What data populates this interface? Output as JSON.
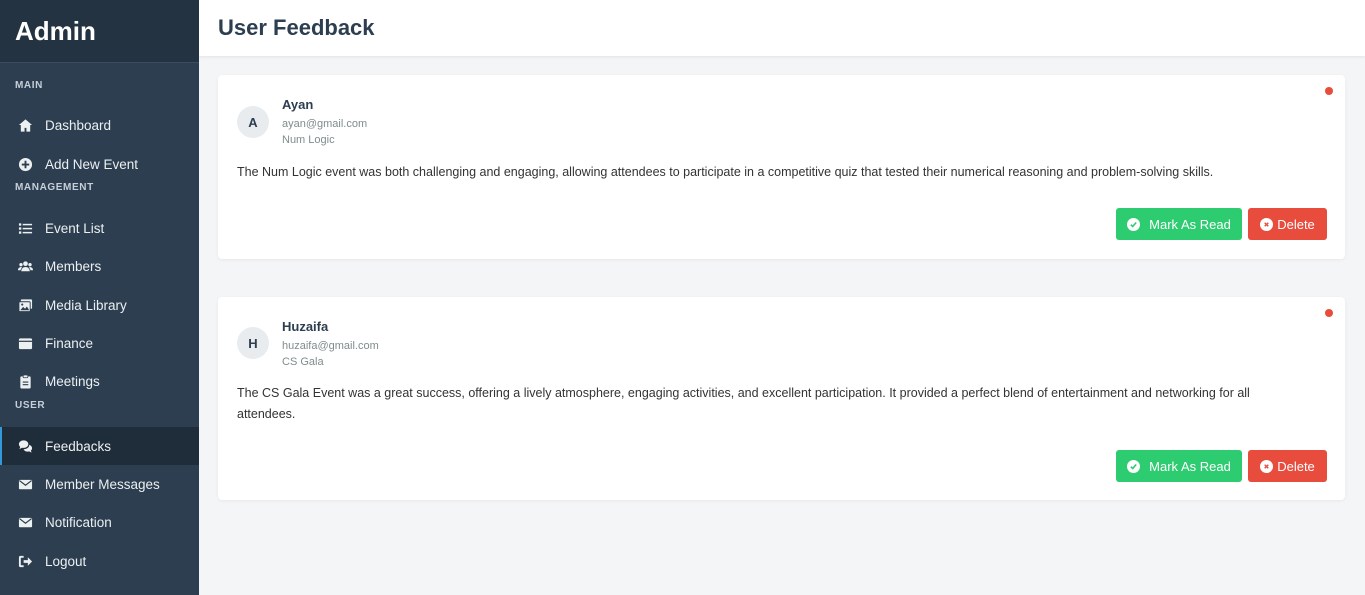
{
  "sidebar": {
    "brand": "Admin",
    "sections": {
      "main": "MAIN",
      "management": "MANAGEMENT",
      "user": "USER"
    },
    "items": [
      {
        "label": "Dashboard",
        "icon": "home-icon"
      },
      {
        "label": "Add New Event",
        "icon": "plus-circle-icon"
      },
      {
        "label": "Event List",
        "icon": "list-icon"
      },
      {
        "label": "Members",
        "icon": "users-icon"
      },
      {
        "label": "Media Library",
        "icon": "images-icon"
      },
      {
        "label": "Finance",
        "icon": "wallet-icon"
      },
      {
        "label": "Meetings",
        "icon": "clipboard-icon"
      },
      {
        "label": "Feedbacks",
        "icon": "comments-icon"
      },
      {
        "label": "Member Messages",
        "icon": "envelope-icon"
      },
      {
        "label": "Notification",
        "icon": "envelope-icon"
      },
      {
        "label": "Logout",
        "icon": "sign-out-icon"
      }
    ],
    "active": "Feedbacks"
  },
  "header": {
    "title": "User Feedback"
  },
  "feedbacks": [
    {
      "initial": "A",
      "name": "Ayan",
      "email": "ayan@gmail.com",
      "event": "Num Logic",
      "message": "The Num Logic event was both challenging and engaging, allowing attendees to participate in a competitive quiz that tested their numerical reasoning and problem-solving skills.",
      "unread": true
    },
    {
      "initial": "H",
      "name": "Huzaifa",
      "email": "huzaifa@gmail.com",
      "event": "CS Gala",
      "message": "The CS Gala Event was a great success, offering a lively atmosphere, engaging activities, and excellent participation. It provided a perfect blend of entertainment and networking for all attendees.",
      "unread": true
    }
  ],
  "actions": {
    "mark_read": "Mark As Read",
    "delete": "Delete"
  },
  "colors": {
    "sidebar": "#2c3e50",
    "success": "#2ecc71",
    "danger": "#e74c3c",
    "accent": "#3498db"
  }
}
